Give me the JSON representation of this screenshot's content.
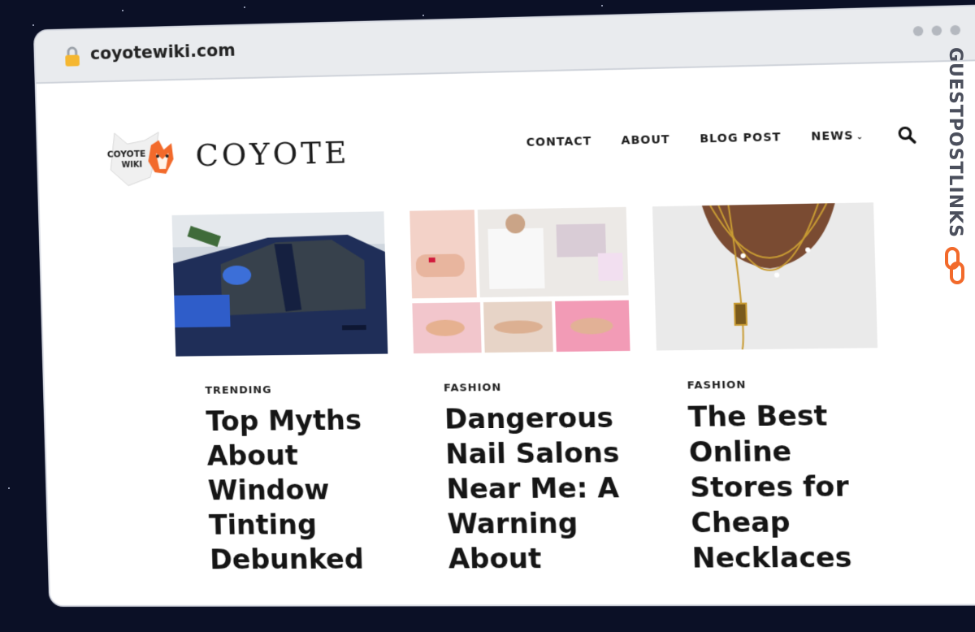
{
  "browser": {
    "url": "coyotewiki.com"
  },
  "site": {
    "logo_text": [
      "COYOTE",
      "WIKI"
    ],
    "brand": "COYOTE",
    "nav": [
      {
        "label": "CONTACT"
      },
      {
        "label": "ABOUT"
      },
      {
        "label": "BLOG POST"
      },
      {
        "label": "NEWS",
        "has_dropdown": true
      }
    ]
  },
  "posts": [
    {
      "category": "TRENDING",
      "title": "Top Myths About Window Tinting Debunked",
      "image": "car-window-tinting-photo"
    },
    {
      "category": "FASHION",
      "title": "Dangerous Nail Salons Near Me: A Warning About",
      "image": "nail-salon-collage-photo"
    },
    {
      "category": "FASHION",
      "title": "The Best Online Stores for Cheap Necklaces",
      "image": "gold-necklaces-photo"
    }
  ],
  "watermark": "GUESTPOSTLINKS",
  "colors": {
    "background": "#0b1026",
    "accent_orange": "#f26a2b"
  }
}
